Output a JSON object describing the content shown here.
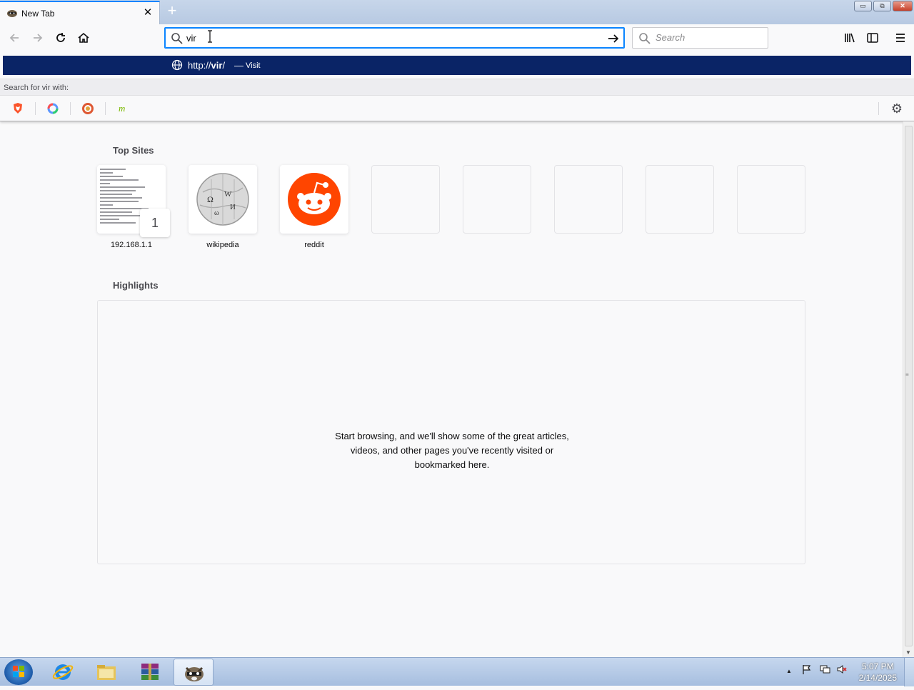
{
  "window": {
    "tab_title": "New Tab",
    "tab_close_glyph": "✕",
    "new_tab_glyph": "+",
    "min_glyph": "▭",
    "restore_glyph": "⧉",
    "close_glyph": "✕"
  },
  "toolbar": {
    "url_value": "vir",
    "search_placeholder": "Search"
  },
  "dropdown": {
    "suggestion_url_prefix": "http://",
    "suggestion_url_bold": "vir",
    "suggestion_url_suffix": "/",
    "suggestion_sep": "—",
    "suggestion_action": "Visit",
    "search_with": "Search for vir with:",
    "engines": [
      "brave-icon",
      "qwant-icon",
      "duckduckgo-icon",
      "mojeek-icon"
    ],
    "settings_glyph": "⚙"
  },
  "newtab": {
    "top_sites_title": "Top Sites",
    "top_sites": [
      {
        "label": "192.168.1.1",
        "pin": "1"
      },
      {
        "label": "wikipedia"
      },
      {
        "label": "reddit"
      }
    ],
    "highlights_title": "Highlights",
    "highlights_empty": [
      "Start browsing, and we'll show some of the great articles,",
      "videos, and other pages you've recently visited or",
      "bookmarked here."
    ]
  },
  "taskbar": {
    "time": "5:07 PM",
    "date": "2/14/2025",
    "tray_arrow": "▲"
  },
  "colors": {
    "accent": "#0a84ff",
    "suggestion_bg": "#0a2466",
    "reddit": "#ff4500"
  }
}
